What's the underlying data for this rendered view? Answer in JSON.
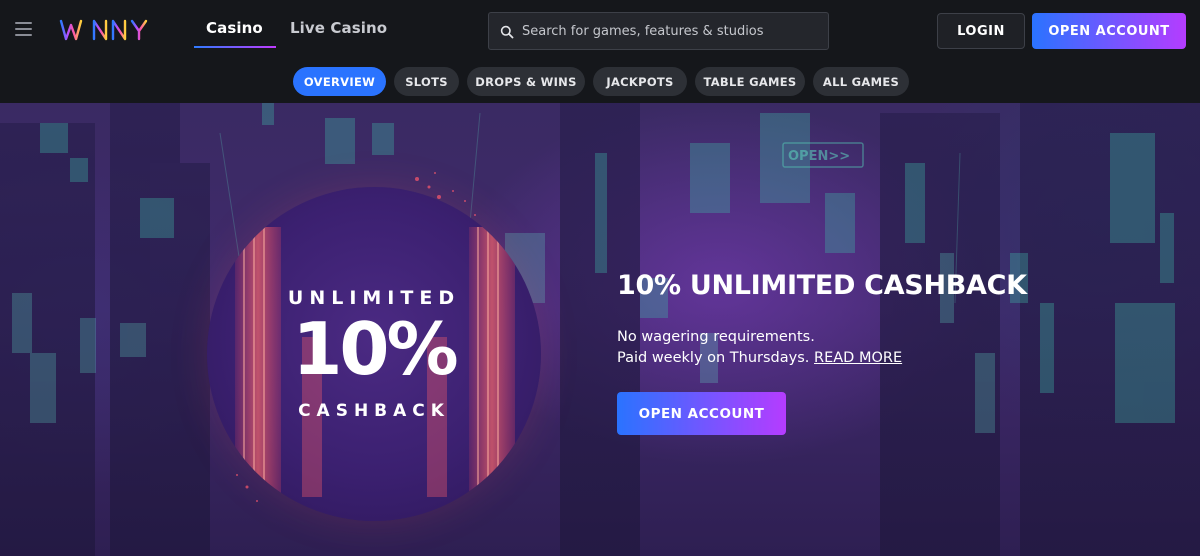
{
  "brand": {
    "name": "WINNY"
  },
  "header": {
    "tabs": [
      {
        "label": "Casino",
        "active": true
      },
      {
        "label": "Live Casino",
        "active": false
      }
    ],
    "search": {
      "placeholder": "Search for games, features & studios"
    },
    "login_label": "LOGIN",
    "open_account_label": "OPEN ACCOUNT"
  },
  "categories": [
    {
      "label": "OVERVIEW",
      "active": true
    },
    {
      "label": "SLOTS",
      "active": false
    },
    {
      "label": "DROPS & WINS",
      "active": false
    },
    {
      "label": "JACKPOTS",
      "active": false
    },
    {
      "label": "TABLE GAMES",
      "active": false
    },
    {
      "label": "ALL GAMES",
      "active": false
    }
  ],
  "hero": {
    "badge": {
      "top": "UNLIMITED",
      "percent": "10%",
      "bottom": "CASHBACK"
    },
    "title": "10% UNLIMITED CASHBACK",
    "line1": "No wagering requirements.",
    "line2": "Paid weekly on Thursdays.",
    "read_more": "READ MORE",
    "cta": "OPEN ACCOUNT",
    "bg_sign": "OPEN>>"
  },
  "colors": {
    "header_bg": "#15171b",
    "accent_blue": "#2a73ff",
    "accent_purple": "#b53cff",
    "pill_bg": "#2d3036",
    "hero_purple": "#3f2a6b"
  }
}
